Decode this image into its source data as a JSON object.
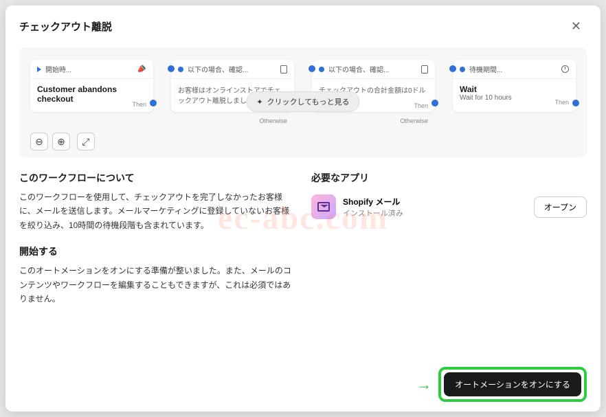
{
  "modal": {
    "title": "チェックアウト離脱",
    "close": "✕"
  },
  "workflow": {
    "nodes": [
      {
        "header": "開始時...",
        "title": "Customer abandons checkout",
        "sub": "",
        "then": "Then",
        "icon": "megaphone",
        "headIcon": "play"
      },
      {
        "header": "以下の場合、確認...",
        "title": "",
        "sub": "お客様はオンラインストアでチェックアウト離脱しました",
        "then": "Then",
        "icon": "clipboard"
      },
      {
        "header": "以下の場合、確認...",
        "title": "",
        "sub": "チェックアウトの合計金額は0ドルを超える",
        "then": "Then",
        "icon": "clipboard"
      },
      {
        "header": "待機期間...",
        "title": "Wait",
        "sub": "Wait for 10 hours",
        "then": "Then",
        "icon": "clock"
      }
    ],
    "otherwise": "Otherwise",
    "clickMore": "クリックしてもっと見る",
    "controls": {
      "minus": "⊖",
      "plus": "⊕",
      "fit": "⤢"
    }
  },
  "sections": {
    "about": {
      "title": "このワークフローについて",
      "body": "このワークフローを使用して、チェックアウトを完了しなかったお客様に、メールを送信します。メールマーケティングに登録していないお客様を絞り込み、10時間の待機段階も含まれています。"
    },
    "start": {
      "title": "開始する",
      "body": "このオートメーションをオンにする準備が整いました。また、メールのコンテンツやワークフローを編集することもできますが、これは必須ではありません。"
    },
    "apps": {
      "title": "必要なアプリ",
      "app": {
        "name": "Shopify メール",
        "status": "インストール済み",
        "open": "オープン"
      }
    }
  },
  "footer": {
    "primary": "オートメーションをオンにする"
  },
  "watermark": "ec-abc.com"
}
